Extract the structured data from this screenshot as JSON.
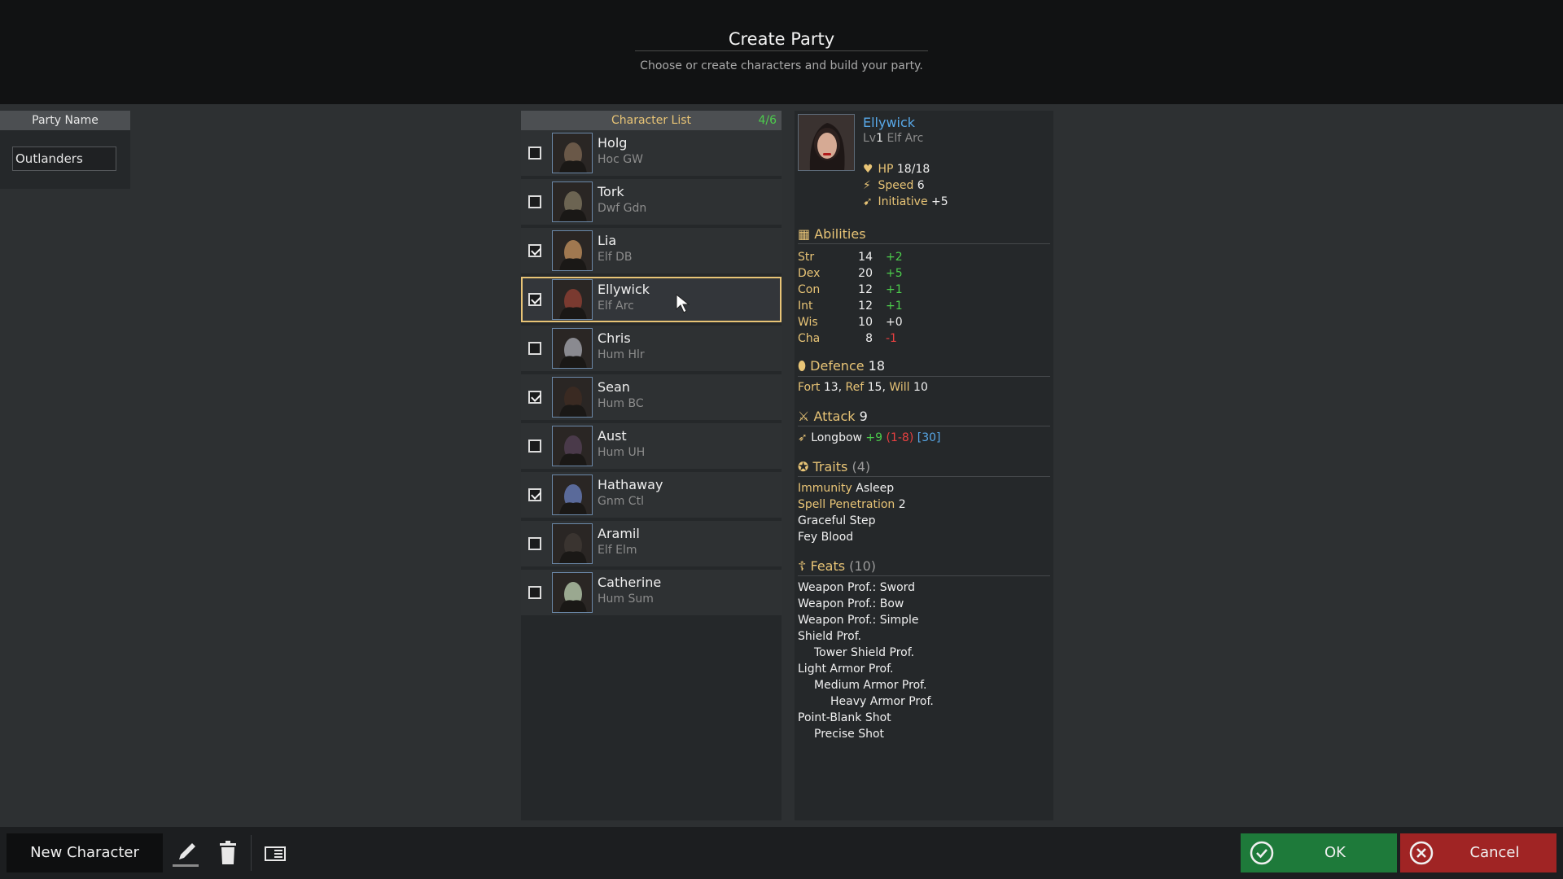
{
  "header": {
    "title": "Create Party",
    "subtitle": "Choose or create characters and build your party."
  },
  "party": {
    "label": "Party Name",
    "value": "Outlanders"
  },
  "character_list": {
    "title": "Character List",
    "count": "4/6",
    "rows": [
      {
        "name": "Holg",
        "sub": "Hoc GW",
        "checked": false,
        "portrait": "#6a5848"
      },
      {
        "name": "Tork",
        "sub": "Dwf Gdn",
        "checked": false,
        "portrait": "#6c6452"
      },
      {
        "name": "Lia",
        "sub": "Elf DB",
        "checked": true,
        "portrait": "#a07850"
      },
      {
        "name": "Ellywick",
        "sub": "Elf Arc",
        "checked": true,
        "portrait": "#7a3a30",
        "selected": true
      },
      {
        "name": "Chris",
        "sub": "Hum Hlr",
        "checked": false,
        "portrait": "#8a8a90"
      },
      {
        "name": "Sean",
        "sub": "Hum BC",
        "checked": true,
        "portrait": "#3a2a22"
      },
      {
        "name": "Aust",
        "sub": "Hum UH",
        "checked": false,
        "portrait": "#4a3a4a"
      },
      {
        "name": "Hathaway",
        "sub": "Gnm Ctl",
        "checked": true,
        "portrait": "#5a6a9a"
      },
      {
        "name": "Aramil",
        "sub": "Elf Elm",
        "checked": false,
        "portrait": "#3a3430"
      },
      {
        "name": "Catherine",
        "sub": "Hum Sum",
        "checked": false,
        "portrait": "#9aa890"
      }
    ]
  },
  "details": {
    "name": "Ellywick",
    "level_prefix": "Lv",
    "level": "1",
    "race_class": "Elf Arc",
    "hp_label": "HP",
    "hp": "18/18",
    "speed_label": "Speed",
    "speed": "6",
    "init_label": "Initiative",
    "init": "+5",
    "abilities_title": "Abilities",
    "abilities": [
      {
        "name": "Str",
        "value": "14",
        "mod": "+2",
        "tone": "green"
      },
      {
        "name": "Dex",
        "value": "20",
        "mod": "+5",
        "tone": "green"
      },
      {
        "name": "Con",
        "value": "12",
        "mod": "+1",
        "tone": "green"
      },
      {
        "name": "Int",
        "value": "12",
        "mod": "+1",
        "tone": "green"
      },
      {
        "name": "Wis",
        "value": "10",
        "mod": "+0",
        "tone": "white"
      },
      {
        "name": "Cha",
        "value": "8",
        "mod": "-1",
        "tone": "red"
      }
    ],
    "defence_title": "Defence",
    "defence": "18",
    "saves": {
      "fort_label": "Fort",
      "fort": "13,",
      "ref_label": "Ref",
      "ref": "15,",
      "will_label": "Will",
      "will": "10"
    },
    "attack_title": "Attack",
    "attack": "9",
    "weapon": {
      "name": "Longbow",
      "bonus": "+9",
      "damage": "(1-8)",
      "range": "[30]"
    },
    "traits_title": "Traits",
    "traits_count": "(4)",
    "traits": [
      {
        "gold": "Immunity",
        "white": "Asleep"
      },
      {
        "gold": "Spell Penetration",
        "white": "2"
      },
      {
        "gold": "",
        "white": "Graceful Step"
      },
      {
        "gold": "",
        "white": "Fey Blood"
      }
    ],
    "feats_title": "Feats",
    "feats_count": "(10)",
    "feats": [
      {
        "text": "Weapon Prof.: Sword",
        "indent": 0
      },
      {
        "text": "Weapon Prof.: Bow",
        "indent": 0
      },
      {
        "text": "Weapon Prof.: Simple",
        "indent": 0
      },
      {
        "text": "Shield Prof.",
        "indent": 0
      },
      {
        "text": "Tower Shield Prof.",
        "indent": 1
      },
      {
        "text": "Light Armor Prof.",
        "indent": 0
      },
      {
        "text": "Medium Armor Prof.",
        "indent": 1
      },
      {
        "text": "Heavy Armor Prof.",
        "indent": 2
      },
      {
        "text": "Point-Blank Shot",
        "indent": 0
      },
      {
        "text": "Precise Shot",
        "indent": 1
      }
    ]
  },
  "footer": {
    "new_character": "New Character",
    "ok": "OK",
    "cancel": "Cancel"
  },
  "icons": {
    "edit": "pencil-icon",
    "delete": "trash-icon",
    "sheet": "character-sheet-icon",
    "ok": "check-circle-icon",
    "cancel": "x-circle-icon"
  },
  "colors": {
    "accent_gold": "#e8c476",
    "positive": "#4ccc4c",
    "negative": "#e84040",
    "link_blue": "#58a8e8",
    "ok_green": "#1e7a3a",
    "cancel_red": "#a02424"
  }
}
